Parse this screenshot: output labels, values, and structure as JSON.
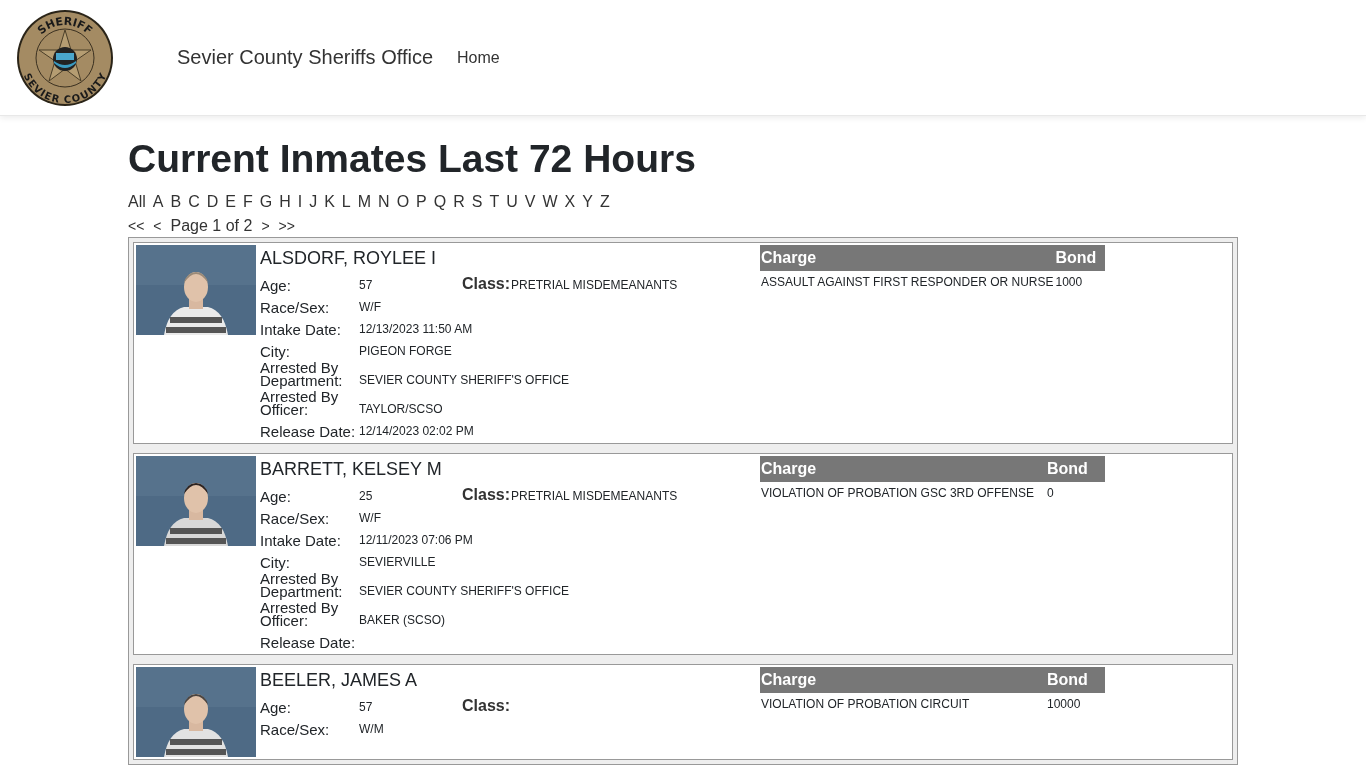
{
  "header": {
    "logo": {
      "top_text": "SHERIFF",
      "bottom_text": "SEVIER COUNTY"
    },
    "brand": "Sevier County Sheriffs Office",
    "nav": [
      {
        "label": "Home"
      }
    ]
  },
  "title": "Current Inmates Last 72 Hours",
  "letters": [
    "All",
    "A",
    "B",
    "C",
    "D",
    "E",
    "F",
    "G",
    "H",
    "I",
    "J",
    "K",
    "L",
    "M",
    "N",
    "O",
    "P",
    "Q",
    "R",
    "S",
    "T",
    "U",
    "V",
    "W",
    "X",
    "Y",
    "Z"
  ],
  "pager": {
    "first": "<<",
    "prev": "<",
    "label": "Page 1 of 2",
    "next": ">",
    "last": ">>"
  },
  "inmates": [
    {
      "name": "ALSDORF, ROYLEE I",
      "age": {
        "label": "Age:",
        "value": "57"
      },
      "class": {
        "label": "Class:",
        "value": "PRETRIAL MISDEMEANANTS"
      },
      "fields": [
        {
          "label": "Race/Sex:",
          "value": "W/F"
        },
        {
          "label": "Intake Date:",
          "value": "12/13/2023 11:50 AM"
        },
        {
          "label": "City:",
          "value": "PIGEON FORGE"
        },
        {
          "label": "Arrested By Department:",
          "value": "SEVIER COUNTY SHERIFF'S OFFICE"
        },
        {
          "label": "Arrested By Officer:",
          "value": "TAYLOR/SCSO"
        },
        {
          "label": "Release Date:",
          "value": "12/14/2023 02:02 PM"
        }
      ],
      "charge_columns": [
        "Charge",
        "Bond"
      ],
      "charges": [
        {
          "charge": "ASSAULT AGAINST FIRST RESPONDER OR NURSE",
          "bond": "1000"
        }
      ]
    },
    {
      "name": "BARRETT, KELSEY M",
      "age": {
        "label": "Age:",
        "value": "25"
      },
      "class": {
        "label": "Class:",
        "value": "PRETRIAL MISDEMEANANTS"
      },
      "fields": [
        {
          "label": "Race/Sex:",
          "value": "W/F"
        },
        {
          "label": "Intake Date:",
          "value": "12/11/2023 07:06 PM"
        },
        {
          "label": "City:",
          "value": "SEVIERVILLE"
        },
        {
          "label": "Arrested By Department:",
          "value": "SEVIER COUNTY SHERIFF'S OFFICE"
        },
        {
          "label": "Arrested By Officer:",
          "value": "BAKER (SCSO)"
        },
        {
          "label": "Release Date:"
        }
      ],
      "charge_columns": [
        "Charge",
        "Bond"
      ],
      "charges": [
        {
          "charge": "VIOLATION OF PROBATION GSC 3RD OFFENSE",
          "bond": "0"
        }
      ]
    },
    {
      "name": "BEELER, JAMES A",
      "age": {
        "label": "Age:",
        "value": "57"
      },
      "class": {
        "label": "Class:"
      },
      "fields": [
        {
          "label": "Race/Sex:",
          "value": "W/M"
        }
      ],
      "charge_columns": [
        "Charge",
        "Bond"
      ],
      "charges": [
        {
          "charge": "VIOLATION OF PROBATION CIRCUIT",
          "bond": "10000"
        }
      ]
    }
  ]
}
